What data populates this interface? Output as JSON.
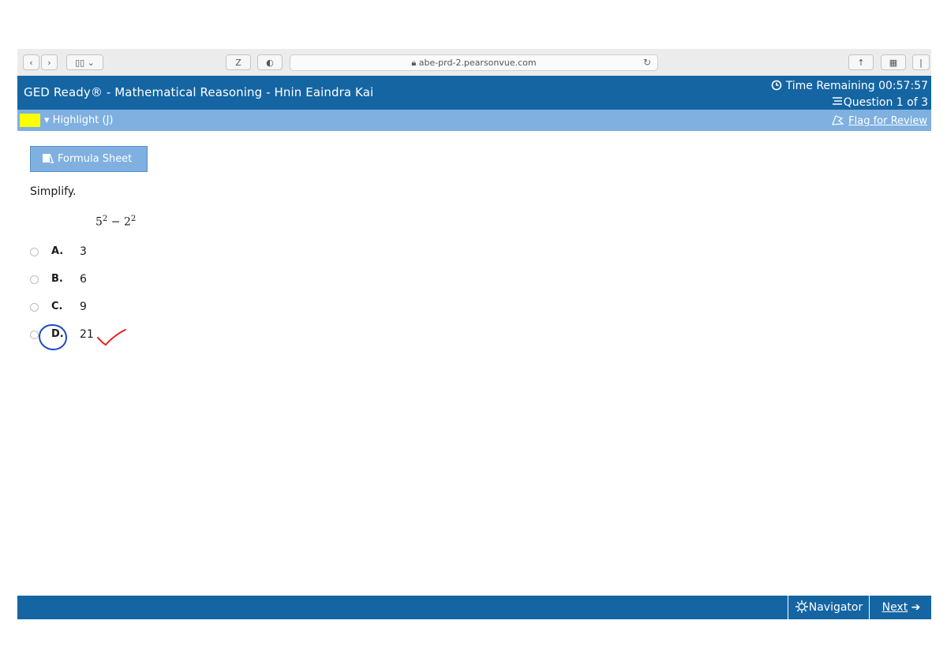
{
  "browser": {
    "url": "abe-prd-2.pearsonvue.com",
    "z_label": "Z"
  },
  "header": {
    "title": "GED Ready® - Mathematical Reasoning - Hnin Eaindra Kai",
    "timer": "Time Remaining 00:57:57",
    "question_count": "Question 1 of 3"
  },
  "highlight_bar": {
    "highlight_label": "Highlight (J)",
    "highlight_color": "#ffff00",
    "flag_label": "Flag for Review"
  },
  "content": {
    "formula_button": "Formula Sheet",
    "prompt": "Simplify.",
    "expression": {
      "base1": "5",
      "exp1": "2",
      "op": "−",
      "base2": "2",
      "exp2": "2"
    },
    "choices": [
      {
        "letter": "A.",
        "value": "3"
      },
      {
        "letter": "B.",
        "value": "6"
      },
      {
        "letter": "C.",
        "value": "9"
      },
      {
        "letter": "D.",
        "value": "21"
      }
    ]
  },
  "footer": {
    "navigator_label": "Navigator",
    "next_label": "Next"
  },
  "colors": {
    "header_blue": "#1565a3",
    "bar_light_blue": "#7fb0e0",
    "ink_blue": "#1a49c9",
    "ink_red": "#e0231c"
  }
}
